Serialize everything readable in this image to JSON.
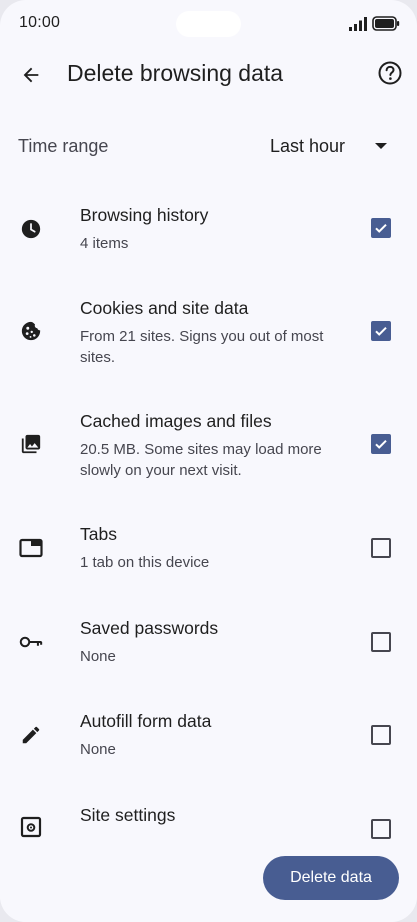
{
  "status_bar": {
    "time": "10:00"
  },
  "app_bar": {
    "title": "Delete browsing data"
  },
  "time_range": {
    "label": "Time range",
    "value": "Last hour"
  },
  "items": [
    {
      "label": "Browsing history",
      "desc": "4 items",
      "checked": true,
      "icon": "clock-icon"
    },
    {
      "label": "Cookies and site data",
      "desc": "From 21 sites. Signs you out of most sites.",
      "checked": true,
      "icon": "cookie-icon"
    },
    {
      "label": "Cached images and files",
      "desc": "20.5 MB. Some sites may load more slowly on your next visit.",
      "checked": true,
      "icon": "image-stack-icon"
    },
    {
      "label": "Tabs",
      "desc": "1 tab on this device",
      "checked": false,
      "icon": "tab-icon"
    },
    {
      "label": "Saved passwords",
      "desc": "None",
      "checked": false,
      "icon": "key-icon"
    },
    {
      "label": "Autofill form data",
      "desc": "None",
      "checked": false,
      "icon": "pencil-icon"
    },
    {
      "label": "Site settings",
      "desc": "",
      "checked": false,
      "icon": "site-settings-icon"
    }
  ],
  "actions": {
    "delete_label": "Delete data"
  },
  "colors": {
    "accent": "#485d92",
    "background": "#f8f8fd",
    "text": "#1f1f1f",
    "secondary_text": "#46464f"
  }
}
